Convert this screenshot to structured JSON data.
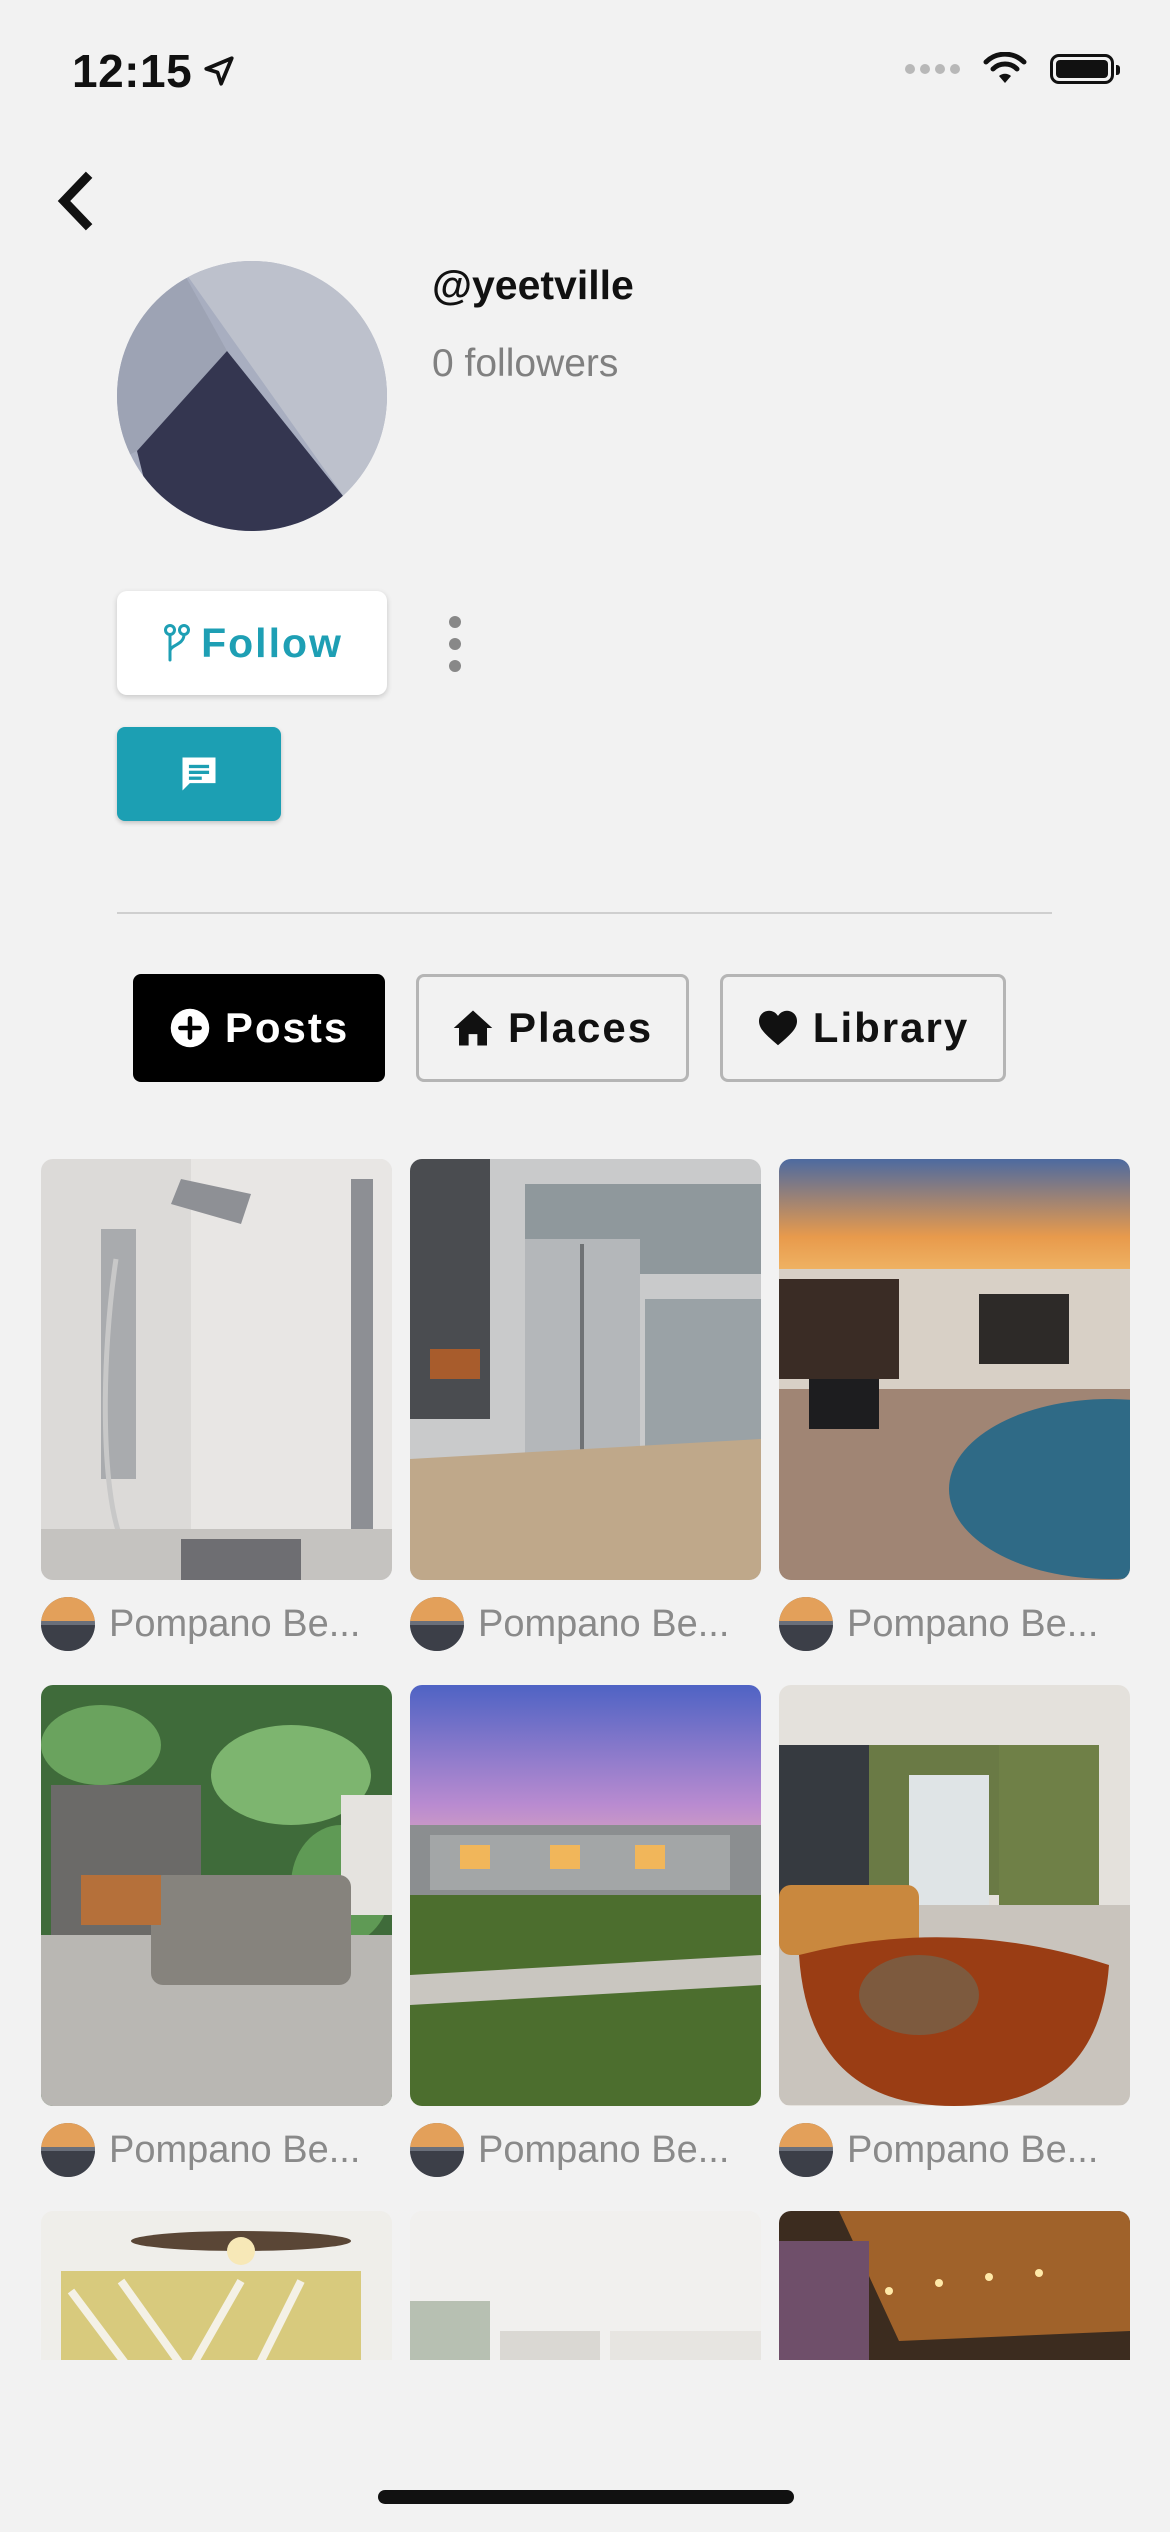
{
  "status_bar": {
    "time": "12:15"
  },
  "profile": {
    "username": "@yeetville",
    "followers": "0 followers",
    "follow_label": "Follow"
  },
  "tabs": [
    {
      "label": "Posts",
      "icon": "plus-circle-icon",
      "active": true
    },
    {
      "label": "Places",
      "icon": "home-icon",
      "active": false
    },
    {
      "label": "Library",
      "icon": "heart-icon",
      "active": false
    }
  ],
  "posts": [
    {
      "caption": "Pompano Be...",
      "scene": "bathroom-shower"
    },
    {
      "caption": "Pompano Be...",
      "scene": "kitchen-fridge"
    },
    {
      "caption": "Pompano Be...",
      "scene": "patio-pool-sunset"
    },
    {
      "caption": "Pompano Be...",
      "scene": "living-room-palm-wallpaper"
    },
    {
      "caption": "Pompano Be...",
      "scene": "house-exterior-dusk"
    },
    {
      "caption": "Pompano Be...",
      "scene": "living-room-cowhide-rug"
    },
    {
      "caption": "",
      "scene": "bedroom-ceiling-fan"
    },
    {
      "caption": "",
      "scene": "bright-room"
    },
    {
      "caption": "",
      "scene": "covered-patio-lights"
    }
  ],
  "colors": {
    "accent": "#1c9fb3",
    "background": "#f2f2f2"
  }
}
